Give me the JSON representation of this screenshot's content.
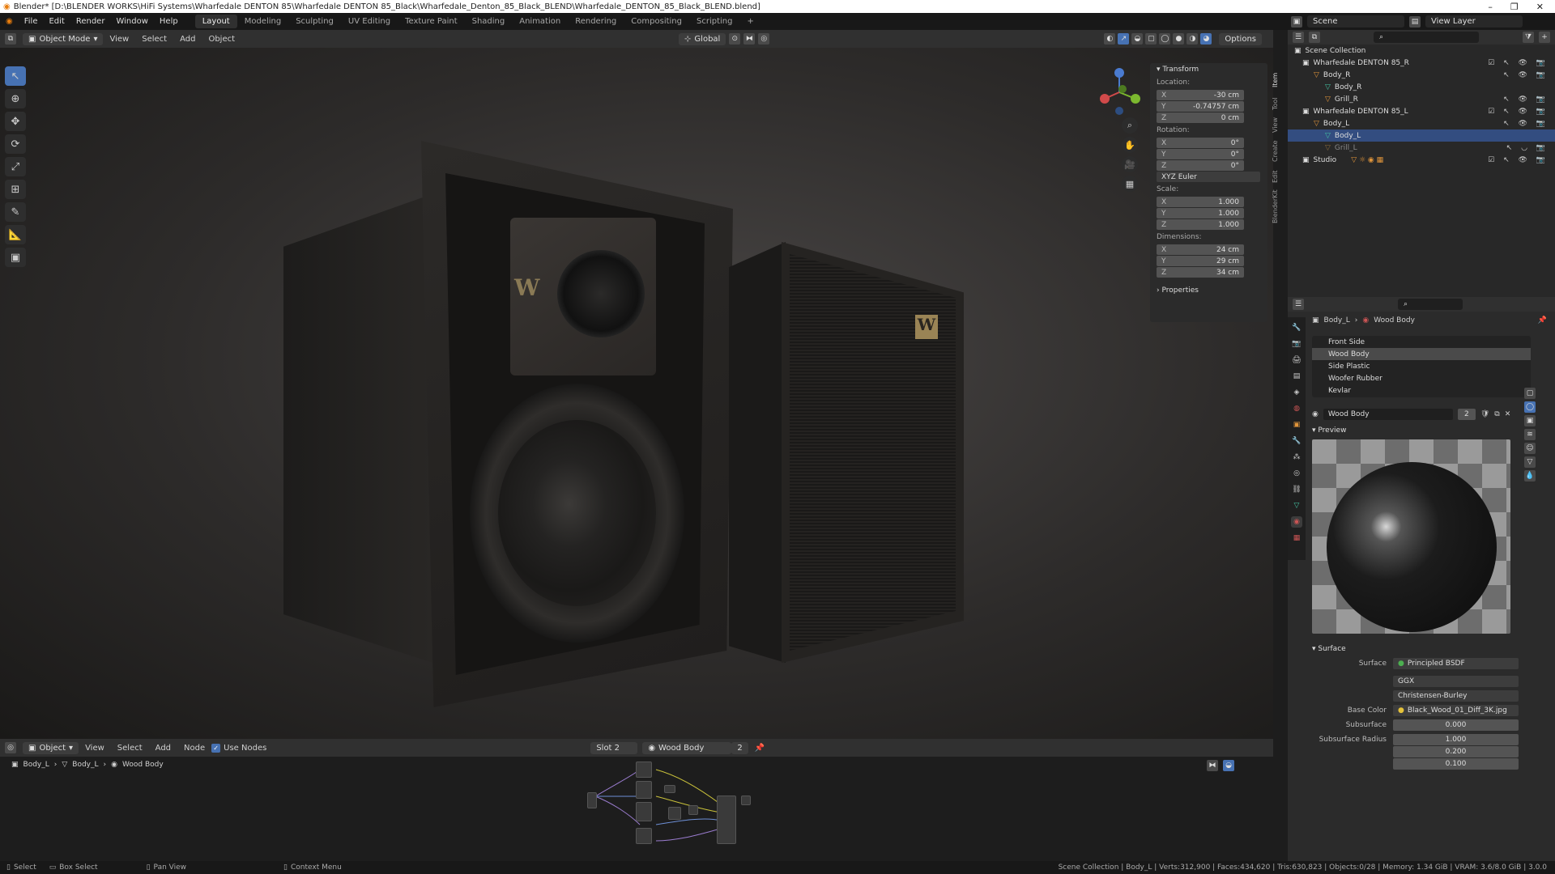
{
  "titlebar": {
    "title": "Blender* [D:\\BLENDER WORKS\\HiFi Systems\\Wharfedale DENTON 85\\Wharfedale DENTON 85_Black\\Wharfedale_Denton_85_Black_BLEND\\Wharfedale_DENTON_85_Black_BLEND.blend]",
    "minimize": "–",
    "maximize": "❐",
    "close": "✕"
  },
  "menu": {
    "items": [
      "File",
      "Edit",
      "Render",
      "Window",
      "Help"
    ],
    "workspaces": [
      "Layout",
      "Modeling",
      "Sculpting",
      "UV Editing",
      "Texture Paint",
      "Shading",
      "Animation",
      "Rendering",
      "Compositing",
      "Scripting"
    ],
    "add_workspace": "+",
    "active_workspace": "Layout",
    "scene_label": "Scene",
    "view_layer_label": "View Layer"
  },
  "viewport_header": {
    "mode": "Object Mode",
    "view": "View",
    "select": "Select",
    "add": "Add",
    "object": "Object",
    "orientation": "Global",
    "options": "Options"
  },
  "npanel": {
    "transform": "Transform",
    "location_label": "Location:",
    "location": [
      {
        "axis": "X",
        "value": "-30 cm"
      },
      {
        "axis": "Y",
        "value": "-0.74757 cm"
      },
      {
        "axis": "Z",
        "value": "0 cm"
      }
    ],
    "rotation_label": "Rotation:",
    "rotation": [
      {
        "axis": "X",
        "value": "0°"
      },
      {
        "axis": "Y",
        "value": "0°"
      },
      {
        "axis": "Z",
        "value": "0°"
      }
    ],
    "rotation_mode": "XYZ Euler",
    "scale_label": "Scale:",
    "scale": [
      {
        "axis": "X",
        "value": "1.000"
      },
      {
        "axis": "Y",
        "value": "1.000"
      },
      {
        "axis": "Z",
        "value": "1.000"
      }
    ],
    "dimensions_label": "Dimensions:",
    "dimensions": [
      {
        "axis": "X",
        "value": "24 cm"
      },
      {
        "axis": "Y",
        "value": "29 cm"
      },
      {
        "axis": "Z",
        "value": "34 cm"
      }
    ],
    "properties": "Properties",
    "tabs": [
      "Item",
      "Tool",
      "View",
      "Create",
      "Edit",
      "BlenderKit"
    ]
  },
  "outliner": {
    "root": "Scene Collection",
    "rows": [
      {
        "label": "Wharfedale DENTON 85_R"
      },
      {
        "label": "Body_R"
      },
      {
        "label": "Body_R"
      },
      {
        "label": "Grill_R"
      },
      {
        "label": "Wharfedale DENTON 85_L"
      },
      {
        "label": "Body_L"
      },
      {
        "label": "Body_L"
      },
      {
        "label": "Grill_L"
      },
      {
        "label": "Studio"
      }
    ]
  },
  "properties": {
    "breadcrumb_object": "Body_L",
    "breadcrumb_material": "Wood Body",
    "slots": [
      "Front Side",
      "Wood Body",
      "Side Plastic",
      "Woofer Rubber",
      "Kevlar"
    ],
    "selected_slot": "Wood Body",
    "material_name": "Wood Body",
    "material_users": "2",
    "preview": "Preview",
    "surface_section": "Surface",
    "surface_label": "Surface",
    "surface_value": "Principled BSDF",
    "distribution": "GGX",
    "subsurface_method": "Christensen-Burley",
    "base_color_label": "Base Color",
    "base_color_value": "Black_Wood_01_Diff_3K.jpg",
    "subsurface_label": "Subsurface",
    "subsurface_value": "0.000",
    "subsurface_radius_label": "Subsurface Radius",
    "subsurface_radius": [
      "1.000",
      "0.200",
      "0.100"
    ]
  },
  "node_header": {
    "editor": "Object",
    "view": "View",
    "select": "Select",
    "add": "Add",
    "node": "Node",
    "use_nodes": "Use Nodes",
    "slot": "Slot 2",
    "material": "Wood Body",
    "users": "2"
  },
  "node_breadcrumb": [
    "Body_L",
    "Body_L",
    "Wood Body"
  ],
  "statusbar": {
    "select": "Select",
    "box_select": "Box Select",
    "pan_view": "Pan View",
    "context_menu": "Context Menu",
    "stats": "Scene Collection | Body_L | Verts:312,900 | Faces:434,620 | Tris:630,823 | Objects:0/28 | Memory: 1.34 GiB | VRAM: 3.6/8.0 GiB | 3.0.0"
  },
  "colors": {
    "accent": "#4772b3",
    "panel": "#2b2b2b",
    "header": "#303030"
  }
}
